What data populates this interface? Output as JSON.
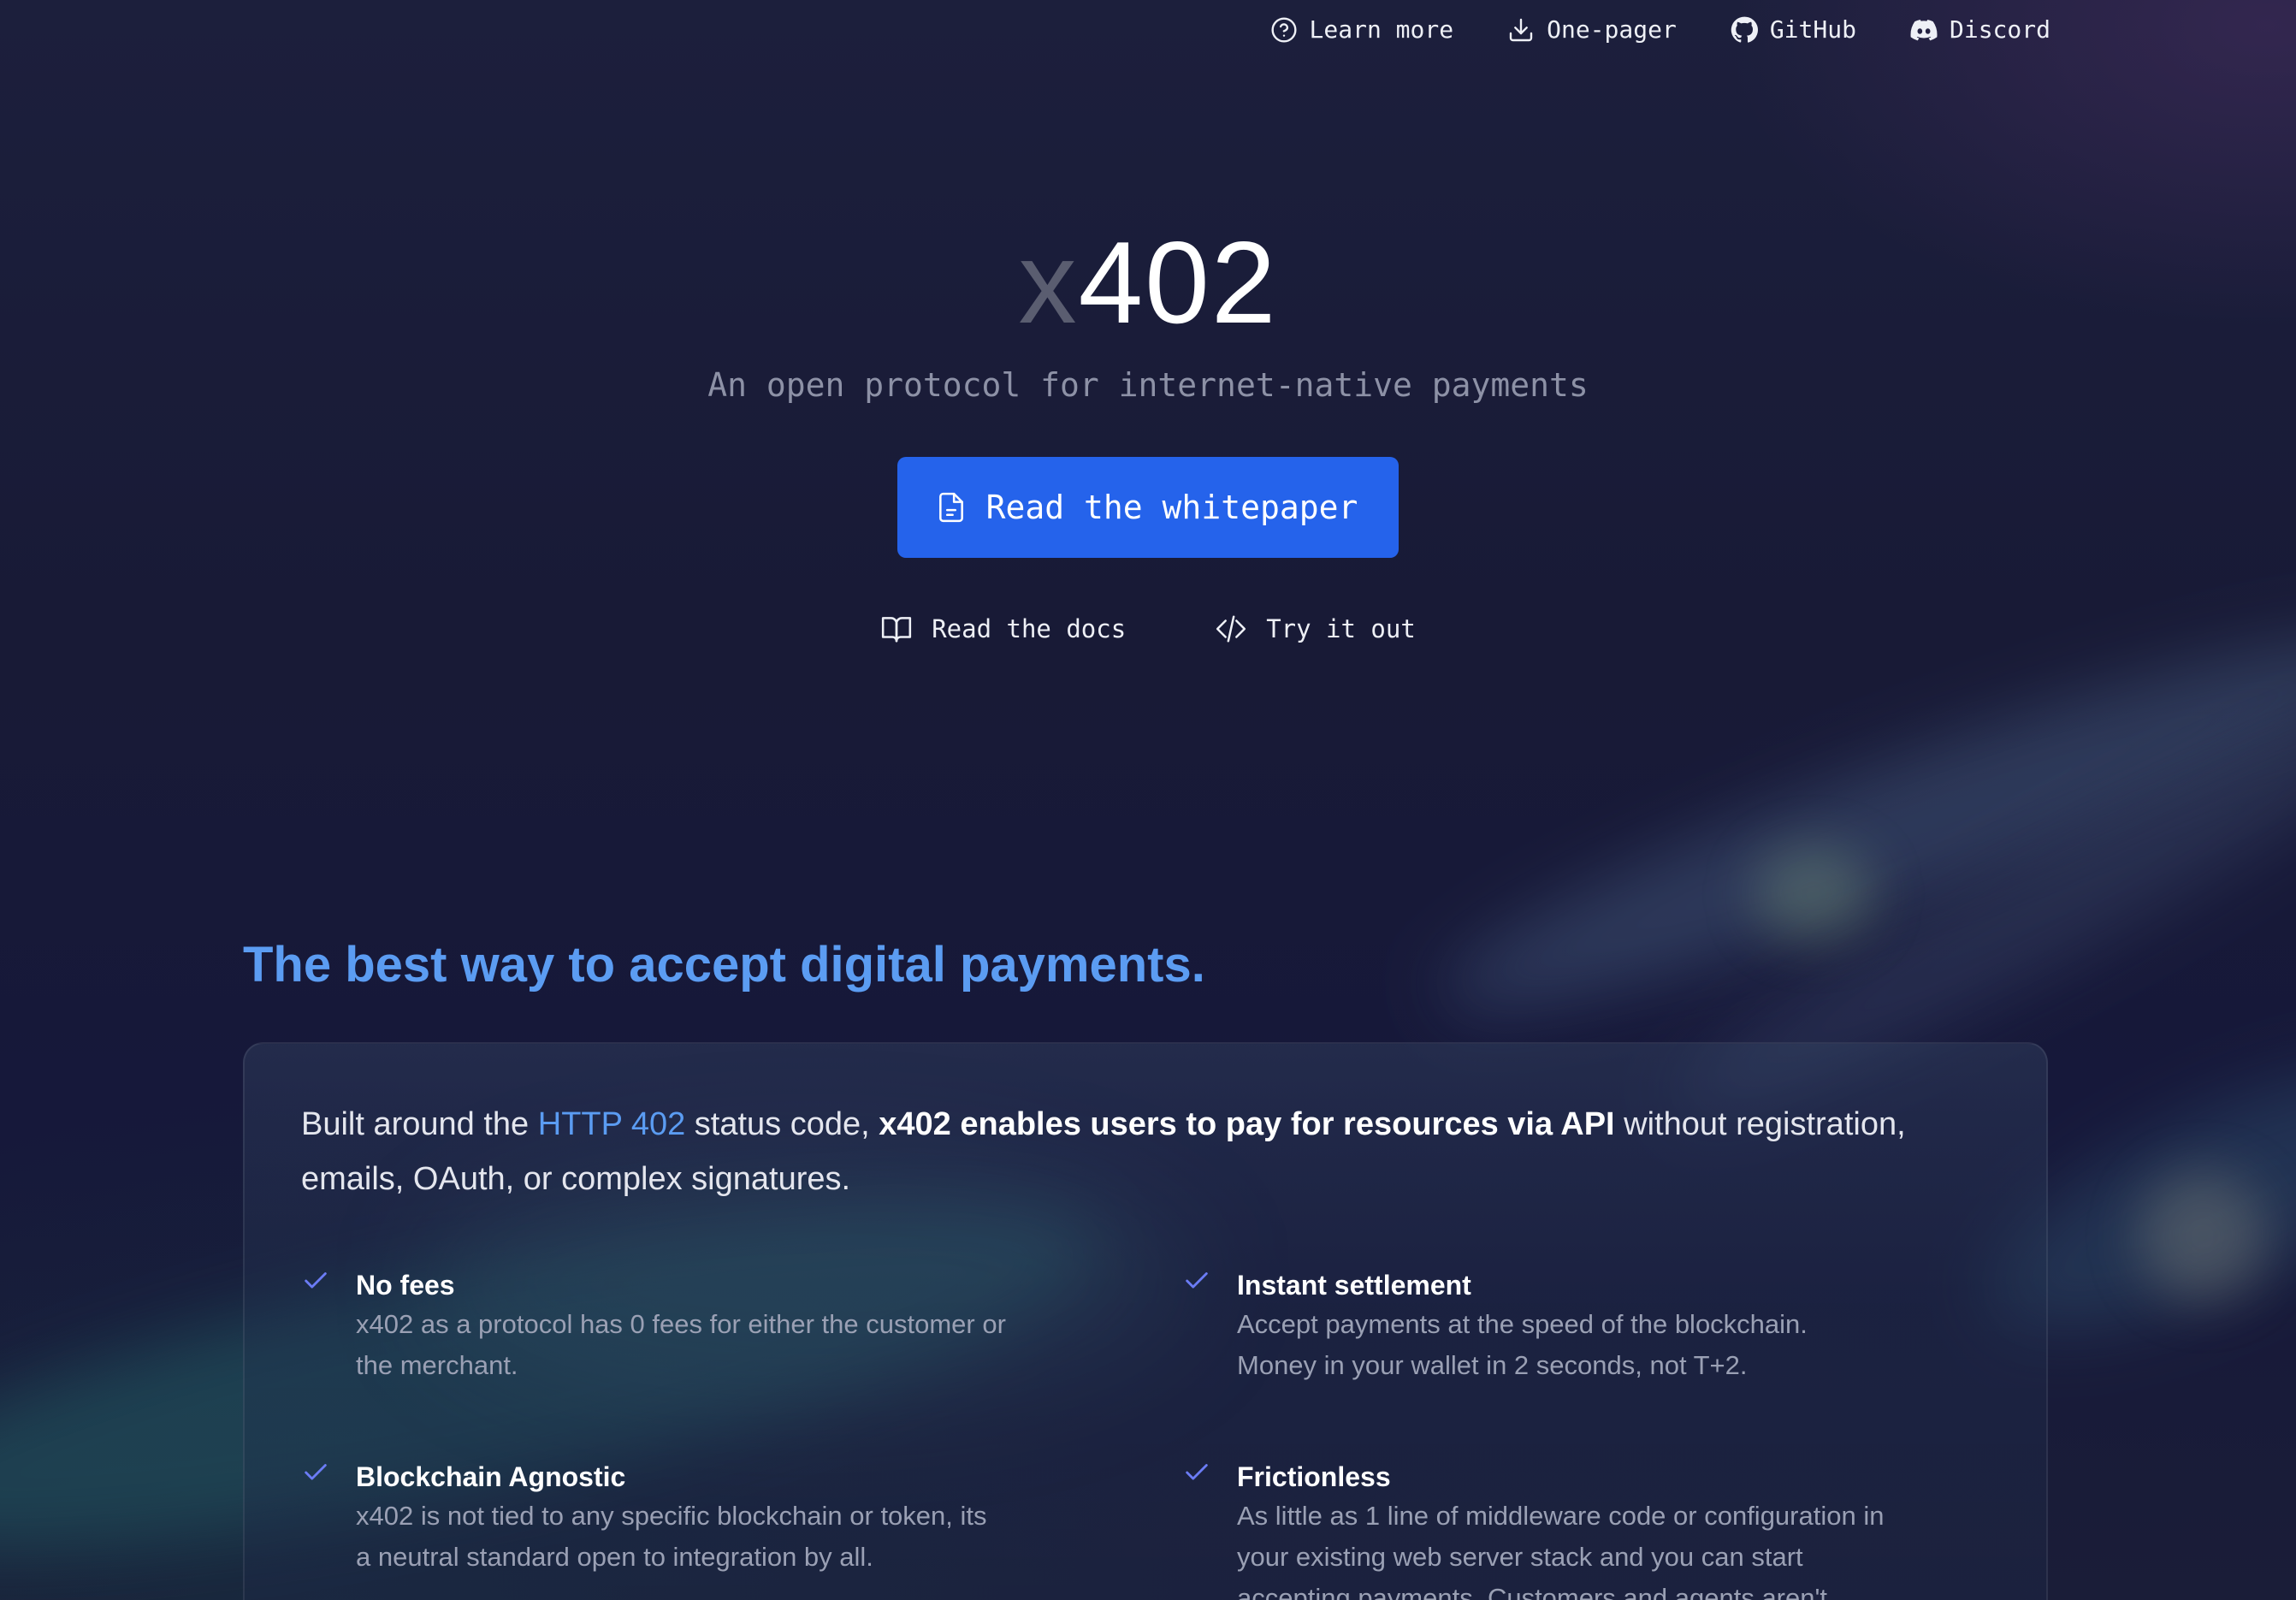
{
  "nav": {
    "learn_more": "Learn more",
    "one_pager": "One-pager",
    "github": "GitHub",
    "discord": "Discord"
  },
  "hero": {
    "logo_prefix": "x",
    "logo_main": "402",
    "tagline": "An open protocol for internet-native payments",
    "cta_label": "Read the whitepaper",
    "docs_label": "Read the docs",
    "try_label": "Try it out"
  },
  "section": {
    "heading": "The best way to accept digital payments.",
    "intro_pre": "Built around the ",
    "intro_link": "HTTP 402",
    "intro_mid": " status code, ",
    "intro_bold": "x402 enables users to pay for resources via API",
    "intro_post": " without registration, emails, OAuth, or complex signatures.",
    "features": [
      {
        "title": "No fees",
        "desc": "x402 as a protocol has 0 fees for either the customer or the merchant."
      },
      {
        "title": "Instant settlement",
        "desc": "Accept payments at the speed of the blockchain. Money in your wallet in 2 seconds, not T+2."
      },
      {
        "title": "Blockchain Agnostic",
        "desc": "x402 is not tied to any specific blockchain or token, its a neutral standard open to integration by all."
      },
      {
        "title": "Frictionless",
        "desc": "As little as 1 line of middleware code or configuration in your existing web server stack and you can start accepting payments. Customers and agents aren't"
      }
    ]
  },
  "colors": {
    "accent": "#2563eb",
    "heading": "#5b9cf2",
    "check": "#6b7cf5",
    "background": "#15172e"
  },
  "icons": [
    "help-circle-icon",
    "download-icon",
    "github-icon",
    "discord-icon",
    "document-icon",
    "book-icon",
    "code-icon",
    "check-icon"
  ]
}
